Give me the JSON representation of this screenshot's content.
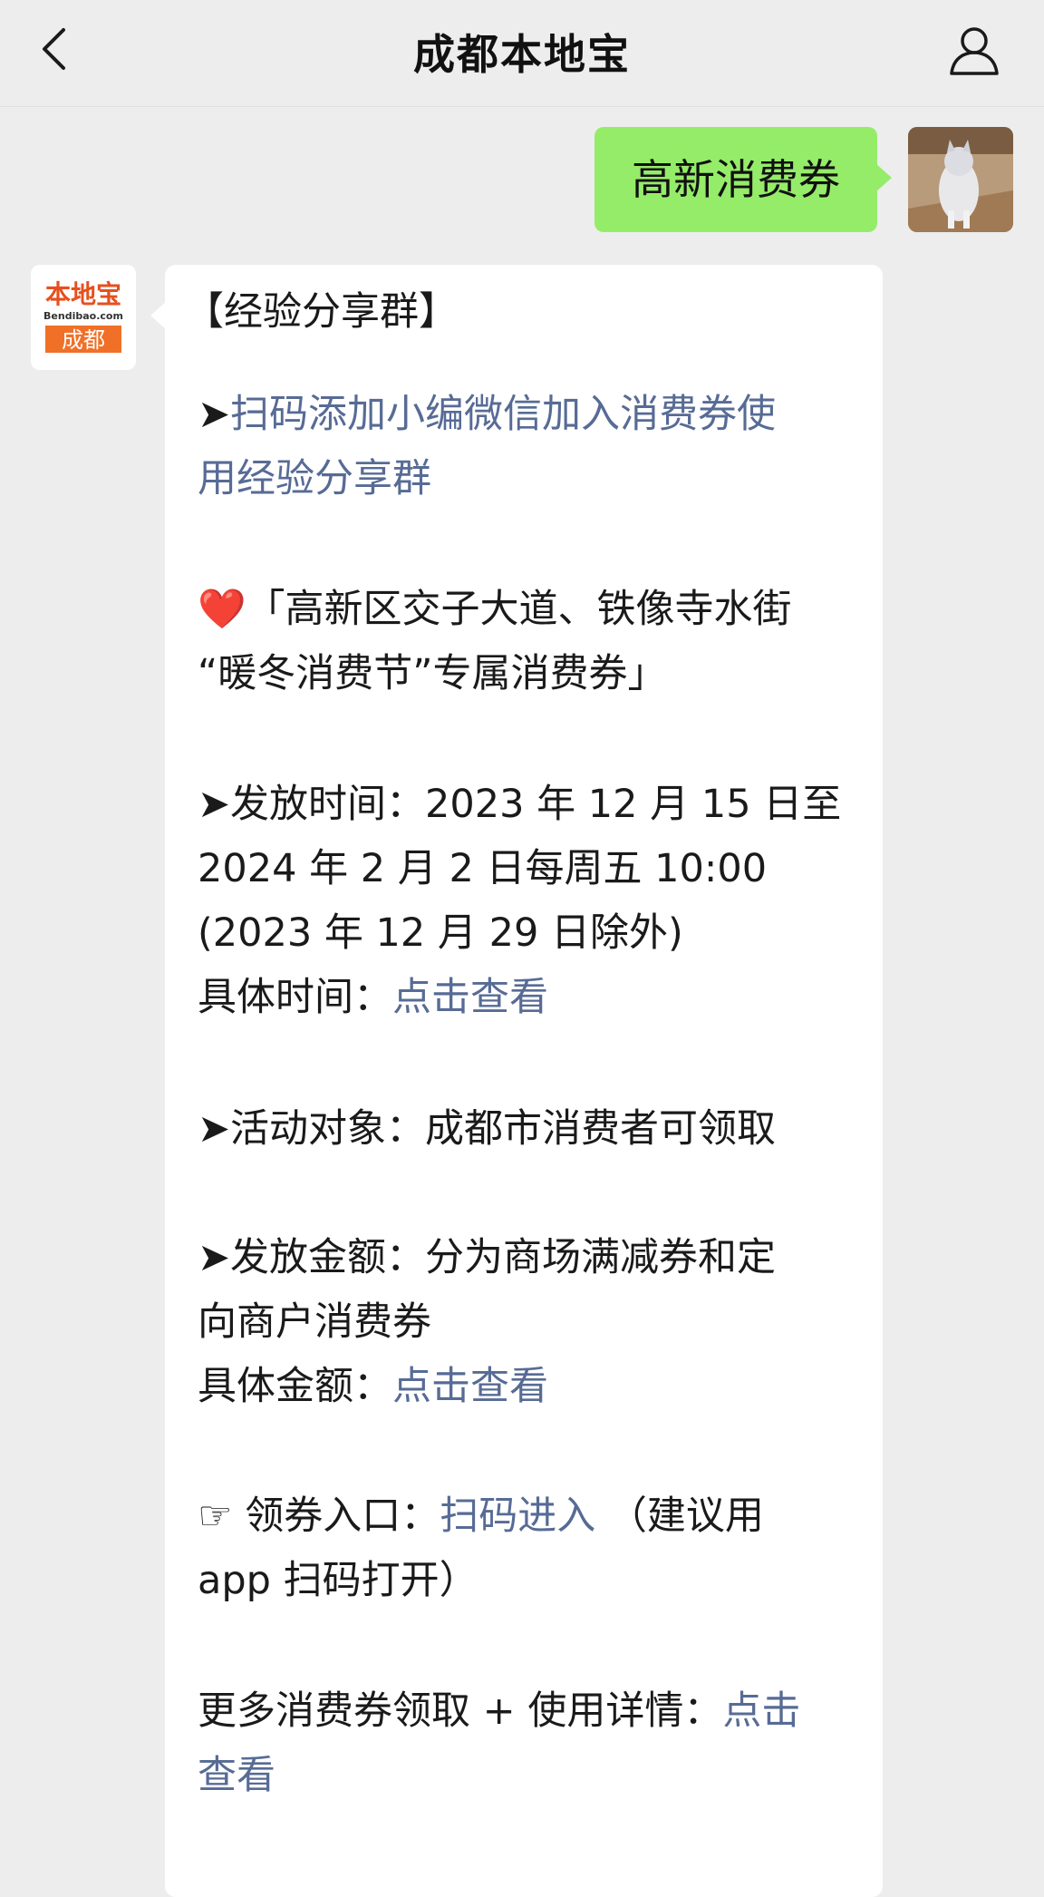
{
  "nav": {
    "title": "成都本地宝"
  },
  "outgoing": {
    "text": "高新消费券"
  },
  "incoming": {
    "avatar": {
      "brand": "本地宝",
      "domain": "Bendibao.com",
      "city": "成都"
    },
    "heading": "【经验分享群】",
    "p1": {
      "bullet": "➤",
      "link": "扫码添加小编微信加入消费券使",
      "link2": "用经验分享群"
    },
    "p2": {
      "icon": "❤️",
      "line1": "「高新区交子大道、铁像寺水街",
      "line2": "“暖冬消费节”专属消费券」"
    },
    "p3": {
      "bullet": "➤",
      "line1": "发放时间：2023 年 12 月 15 日至",
      "line2": "2024 年 2 月 2 日每周五 10:00",
      "line3": "(2023 年 12 月 29 日除外)",
      "detail_label": "具体时间：",
      "detail_link": "点击查看"
    },
    "p4": {
      "bullet": "➤",
      "text": "活动对象：成都市消费者可领取"
    },
    "p5": {
      "bullet": "➤",
      "line1": "发放金额：分为商场满减券和定",
      "line2": "向商户消费券",
      "detail_label": "具体金额：",
      "detail_link": "点击查看"
    },
    "p6": {
      "icon": "☞",
      "label": "领券入口：",
      "link": "扫码进入",
      "suffix": "（建议用",
      "line2": "app 扫码打开）"
    },
    "p7": {
      "label": "更多消费券领取 + 使用详情：",
      "link": "点击",
      "link2": "查看"
    }
  }
}
